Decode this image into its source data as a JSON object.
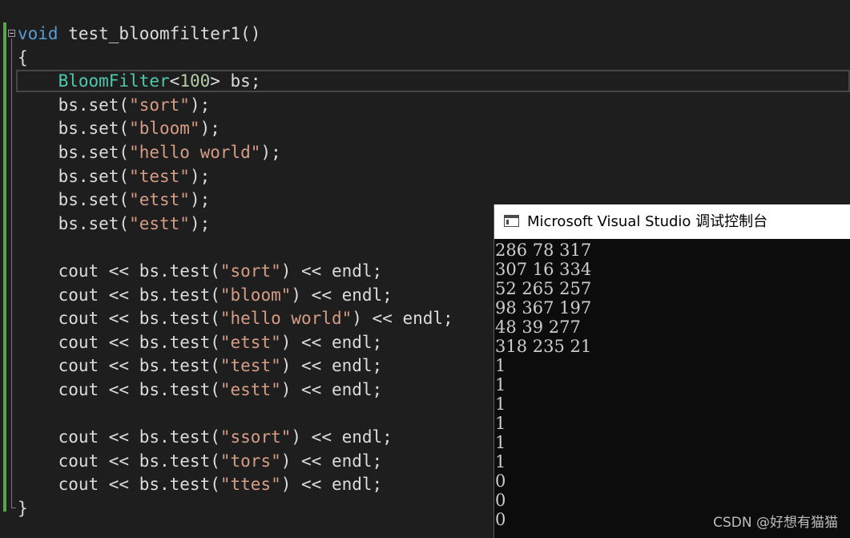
{
  "editor": {
    "lines": [
      [
        {
          "t": "void",
          "c": "kw"
        },
        {
          "t": " test_bloomfilter1()",
          "c": "txt"
        }
      ],
      [
        {
          "t": "{",
          "c": "txt"
        }
      ],
      [
        {
          "t": "    ",
          "c": "txt"
        },
        {
          "t": "BloomFilter",
          "c": "ty"
        },
        {
          "t": "<",
          "c": "txt"
        },
        {
          "t": "100",
          "c": "num"
        },
        {
          "t": "> bs;",
          "c": "txt"
        }
      ],
      [
        {
          "t": "    bs.set(",
          "c": "txt"
        },
        {
          "t": "\"sort\"",
          "c": "str"
        },
        {
          "t": ");",
          "c": "txt"
        }
      ],
      [
        {
          "t": "    bs.set(",
          "c": "txt"
        },
        {
          "t": "\"bloom\"",
          "c": "str"
        },
        {
          "t": ");",
          "c": "txt"
        }
      ],
      [
        {
          "t": "    bs.set(",
          "c": "txt"
        },
        {
          "t": "\"hello world\"",
          "c": "str"
        },
        {
          "t": ");",
          "c": "txt"
        }
      ],
      [
        {
          "t": "    bs.set(",
          "c": "txt"
        },
        {
          "t": "\"test\"",
          "c": "str"
        },
        {
          "t": ");",
          "c": "txt"
        }
      ],
      [
        {
          "t": "    bs.set(",
          "c": "txt"
        },
        {
          "t": "\"etst\"",
          "c": "str"
        },
        {
          "t": ");",
          "c": "txt"
        }
      ],
      [
        {
          "t": "    bs.set(",
          "c": "txt"
        },
        {
          "t": "\"estt\"",
          "c": "str"
        },
        {
          "t": ");",
          "c": "txt"
        }
      ],
      [],
      [
        {
          "t": "    cout << bs.test(",
          "c": "txt"
        },
        {
          "t": "\"sort\"",
          "c": "str"
        },
        {
          "t": ") << endl;",
          "c": "txt"
        }
      ],
      [
        {
          "t": "    cout << bs.test(",
          "c": "txt"
        },
        {
          "t": "\"bloom\"",
          "c": "str"
        },
        {
          "t": ") << endl;",
          "c": "txt"
        }
      ],
      [
        {
          "t": "    cout << bs.test(",
          "c": "txt"
        },
        {
          "t": "\"hello world\"",
          "c": "str"
        },
        {
          "t": ") << endl;",
          "c": "txt"
        }
      ],
      [
        {
          "t": "    cout << bs.test(",
          "c": "txt"
        },
        {
          "t": "\"etst\"",
          "c": "str"
        },
        {
          "t": ") << endl;",
          "c": "txt"
        }
      ],
      [
        {
          "t": "    cout << bs.test(",
          "c": "txt"
        },
        {
          "t": "\"test\"",
          "c": "str"
        },
        {
          "t": ") << endl;",
          "c": "txt"
        }
      ],
      [
        {
          "t": "    cout << bs.test(",
          "c": "txt"
        },
        {
          "t": "\"estt\"",
          "c": "str"
        },
        {
          "t": ") << endl;",
          "c": "txt"
        }
      ],
      [],
      [
        {
          "t": "    cout << bs.test(",
          "c": "txt"
        },
        {
          "t": "\"ssort\"",
          "c": "str"
        },
        {
          "t": ") << endl;",
          "c": "txt"
        }
      ],
      [
        {
          "t": "    cout << bs.test(",
          "c": "txt"
        },
        {
          "t": "\"tors\"",
          "c": "str"
        },
        {
          "t": ") << endl;",
          "c": "txt"
        }
      ],
      [
        {
          "t": "    cout << bs.test(",
          "c": "txt"
        },
        {
          "t": "\"ttes\"",
          "c": "str"
        },
        {
          "t": ") << endl;",
          "c": "txt"
        }
      ],
      [
        {
          "t": "}",
          "c": "txt"
        }
      ]
    ],
    "icons": {
      "fold": "fold-collapse-icon"
    }
  },
  "console": {
    "title": "Microsoft Visual Studio 调试控制台",
    "icon": "console-window-icon",
    "output": [
      "286 78 317",
      "307 16 334",
      "52 265 257",
      "98 367 197",
      "48 39 277",
      "318 235 21",
      "1",
      "1",
      "1",
      "1",
      "1",
      "1",
      "0",
      "0",
      "0"
    ]
  },
  "watermark": "CSDN @好想有猫猫",
  "colors": {
    "keyword": "#569cd6",
    "type": "#4ec9b0",
    "number": "#b5cea8",
    "string": "#d69d85",
    "text": "#dcdcdc",
    "editor_bg": "#1e1e1e",
    "console_bg": "#0c0c0c",
    "change_bar": "#57a64a"
  }
}
